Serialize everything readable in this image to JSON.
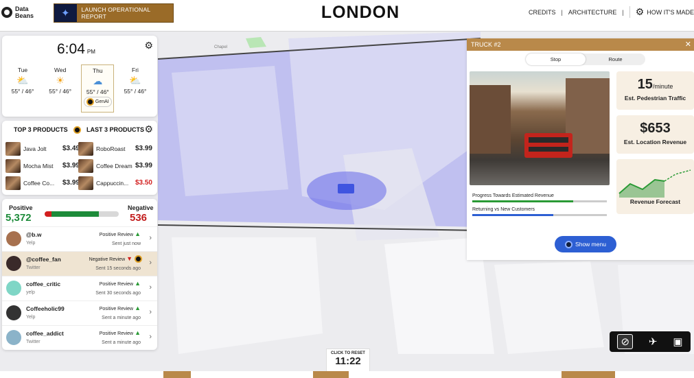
{
  "header": {
    "logo_line1": "Data",
    "logo_line2": "Beans",
    "launch_label": "LAUNCH OPERATIONAL REPORT",
    "city": "LONDON",
    "nav": [
      "CREDITS",
      "ARCHITECTURE"
    ],
    "how_label": "HOW IT'S MADE"
  },
  "map": {
    "label_chapel": "Chapel"
  },
  "weather": {
    "time": "6:04",
    "ampm": "PM",
    "days": [
      {
        "name": "Tue",
        "temp": "55° / 46°"
      },
      {
        "name": "Wed",
        "temp": "55° / 46°"
      },
      {
        "name": "Thu",
        "temp": "55° / 46°",
        "genai": "GenAI"
      },
      {
        "name": "Fri",
        "temp": "55° / 46°"
      }
    ]
  },
  "products": {
    "top_title": "TOP 3 PRODUCTS",
    "last_title": "LAST 3 PRODUCTS",
    "top": [
      {
        "name": "Java Jolt",
        "price": "$3.49"
      },
      {
        "name": "Mocha Mist",
        "price": "$3.99"
      },
      {
        "name": "Coffee Co...",
        "price": "$3.99"
      }
    ],
    "last": [
      {
        "name": "RoboRoast",
        "price": "$3.99"
      },
      {
        "name": "Coffee Dream",
        "price": "$3.99"
      },
      {
        "name": "Cappuccin...",
        "price": "$3.50"
      }
    ]
  },
  "sentiment": {
    "positive_label": "Positive",
    "positive_count": "5,372",
    "negative_label": "Negative",
    "negative_count": "536",
    "negative_share": 0.091
  },
  "reviews": [
    {
      "handle": "@b.w",
      "source": "Yelp",
      "type": "Positive Review",
      "time": "Sent just now"
    },
    {
      "handle": "@coffee_fan",
      "source": "Twitter",
      "type": "Negative Review",
      "time": "Sent 15 seconds ago"
    },
    {
      "handle": "coffee_critic",
      "source": "yelp",
      "type": "Positive Review",
      "time": "Sent 30 seconds ago"
    },
    {
      "handle": "Coffeeholic99",
      "source": "Yelp",
      "type": "Positive Review",
      "time": "Sent a minute ago"
    },
    {
      "handle": "coffee_addict",
      "source": "Twitter",
      "type": "Positive Review",
      "time": "Sent a minute ago"
    }
  ],
  "truck": {
    "title": "TRUCK #2",
    "tabs": [
      "Stop",
      "Route"
    ],
    "traffic_value": "15",
    "traffic_unit": "/minute",
    "traffic_label": "Est. Pedestrian Traffic",
    "revenue_value": "$653",
    "revenue_label": "Est. Location Revenue",
    "forecast_label": "Revenue Forecast",
    "progress": [
      {
        "label": "Progress Towards Estimated Revenue",
        "value": 0.75,
        "color": "#2a9a35"
      },
      {
        "label": "Returning vs New Customers",
        "value": 0.6,
        "color": "#2d5fd3"
      }
    ],
    "show_menu": "Show menu"
  },
  "reset": {
    "label": "CLICK TO RESET",
    "time": "11:22"
  }
}
